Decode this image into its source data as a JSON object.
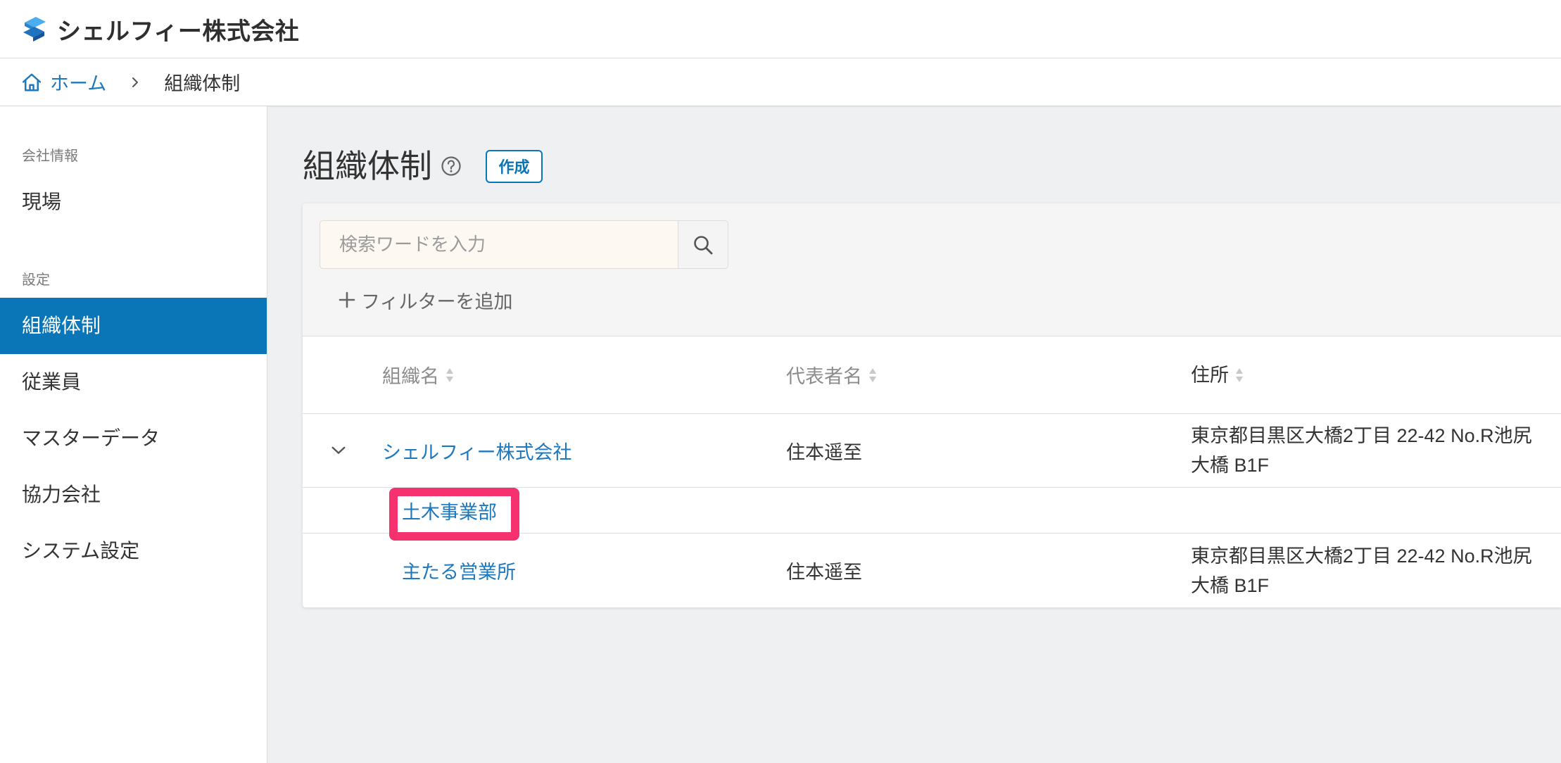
{
  "header": {
    "company_name": "シェルフィー株式会社",
    "logo": "shelfy-logo-icon"
  },
  "breadcrumb": {
    "home_icon": "home-icon",
    "home_label": "ホーム",
    "separator_icon": "chevron-right-icon",
    "current": "組織体制"
  },
  "sidebar": {
    "sections": [
      {
        "label": "会社情報",
        "items": [
          {
            "label": "現場",
            "active": false
          }
        ]
      },
      {
        "label": "設定",
        "items": [
          {
            "label": "組織体制",
            "active": true
          },
          {
            "label": "従業員",
            "active": false
          },
          {
            "label": "マスターデータ",
            "active": false
          },
          {
            "label": "協力会社",
            "active": false
          },
          {
            "label": "システム設定",
            "active": false
          }
        ]
      }
    ]
  },
  "page": {
    "title": "組織体制",
    "help_icon": "question-circle-icon",
    "create_button": "作成"
  },
  "search": {
    "placeholder": "検索ワードを入力",
    "value": "",
    "search_icon": "search-icon",
    "add_filter_icon": "plus-icon",
    "add_filter_label": "フィルターを追加"
  },
  "table": {
    "columns": [
      {
        "label": "組織名",
        "sortable": true
      },
      {
        "label": "代表者名",
        "sortable": true
      },
      {
        "label": "住所",
        "sortable": true
      }
    ],
    "rows": [
      {
        "name": "シェルフィー株式会社",
        "representative": "住本遥至",
        "address": "東京都目黒区大橋2丁目 22-42 No.R池尻大橋 B1F",
        "expanded": true,
        "toggle_icon": "chevron-down-icon",
        "children": [
          {
            "name": "土木事業部",
            "highlighted": true
          },
          {
            "name": "主たる営業所",
            "representative": "住本遥至",
            "address": "東京都目黒区大橋2丁目 22-42 No.R池尻大橋 B1F"
          }
        ]
      }
    ]
  },
  "colors": {
    "accent": "#0b76b7",
    "link": "#1e78bd",
    "highlight": "#f5316f",
    "page_background": "#eff0f2",
    "search_input_background": "#fdf8f1"
  }
}
